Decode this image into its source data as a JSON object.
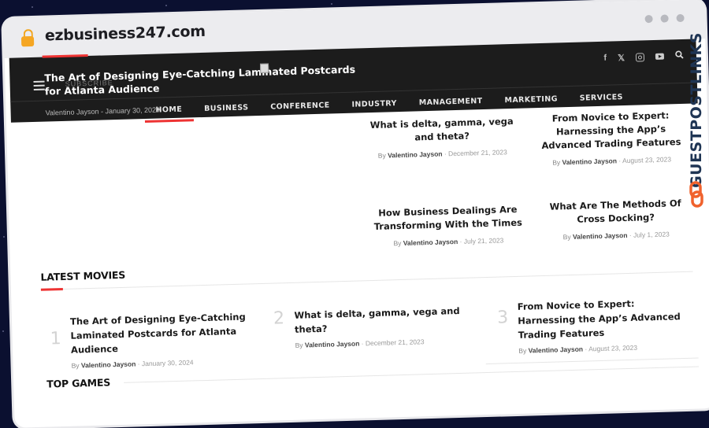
{
  "browser": {
    "url": "ezbusiness247.com",
    "lock_icon": "lock-icon",
    "window_controls": [
      "dot",
      "dot",
      "dot"
    ]
  },
  "header": {
    "subscribe_label": "SUBSCRIBE",
    "hero": {
      "title": "The Art of Designing Eye-Catching Laminated Postcards for Atlanta Audience",
      "author": "Valentino Jayson",
      "date": "January 30, 2024",
      "separator": "-"
    },
    "social_icons": [
      "facebook-icon",
      "x-icon",
      "instagram-icon",
      "youtube-icon",
      "search-icon"
    ],
    "social_glyphs": {
      "facebook": "f",
      "x": "𝕏",
      "search": "⚲"
    }
  },
  "nav": {
    "items": [
      {
        "label": "HOME",
        "active": true
      },
      {
        "label": "BUSINESS"
      },
      {
        "label": "CONFERENCE"
      },
      {
        "label": "INDUSTRY"
      },
      {
        "label": "MANAGEMENT"
      },
      {
        "label": "MARKETING"
      },
      {
        "label": "SERVICES"
      }
    ]
  },
  "grid_posts": [
    {
      "title": "What is delta, gamma, vega and theta?",
      "by": "By",
      "author": "Valentino Jayson",
      "date": "December 21, 2023"
    },
    {
      "title": "From Novice to Expert: Harnessing the App’s Advanced Trading Features",
      "by": "By",
      "author": "Valentino Jayson",
      "date": "August 23, 2023"
    },
    {
      "title": "How Business Dealings Are Transforming With the Times",
      "by": "By",
      "author": "Valentino Jayson",
      "date": "July 21, 2023"
    },
    {
      "title": "What Are The Methods Of Cross Docking?",
      "by": "By",
      "author": "Valentino Jayson",
      "date": "July 1, 2023"
    }
  ],
  "latest_movies": {
    "title": "LATEST MOVIES",
    "items": [
      {
        "num": "1",
        "title": "The Art of Designing Eye-Catching Laminated Postcards for Atlanta Audience",
        "by": "By",
        "author": "Valentino Jayson",
        "date": "January 30, 2024"
      },
      {
        "num": "2",
        "title": "What is delta, gamma, vega and theta?",
        "by": "By",
        "author": "Valentino Jayson",
        "date": "December 21, 2023"
      },
      {
        "num": "3",
        "title": "From Novice to Expert: Harnessing the App’s Advanced Trading Features",
        "by": "By",
        "author": "Valentino Jayson",
        "date": "August 23, 2023"
      }
    ]
  },
  "top_games": {
    "title": "TOP GAMES"
  },
  "badge": {
    "text": "GUESTPOSTLINKS",
    "accent": "#f0622d",
    "color": "#1f3554"
  },
  "colors": {
    "accent": "#e33333",
    "header_bg": "#1c1c1c"
  }
}
